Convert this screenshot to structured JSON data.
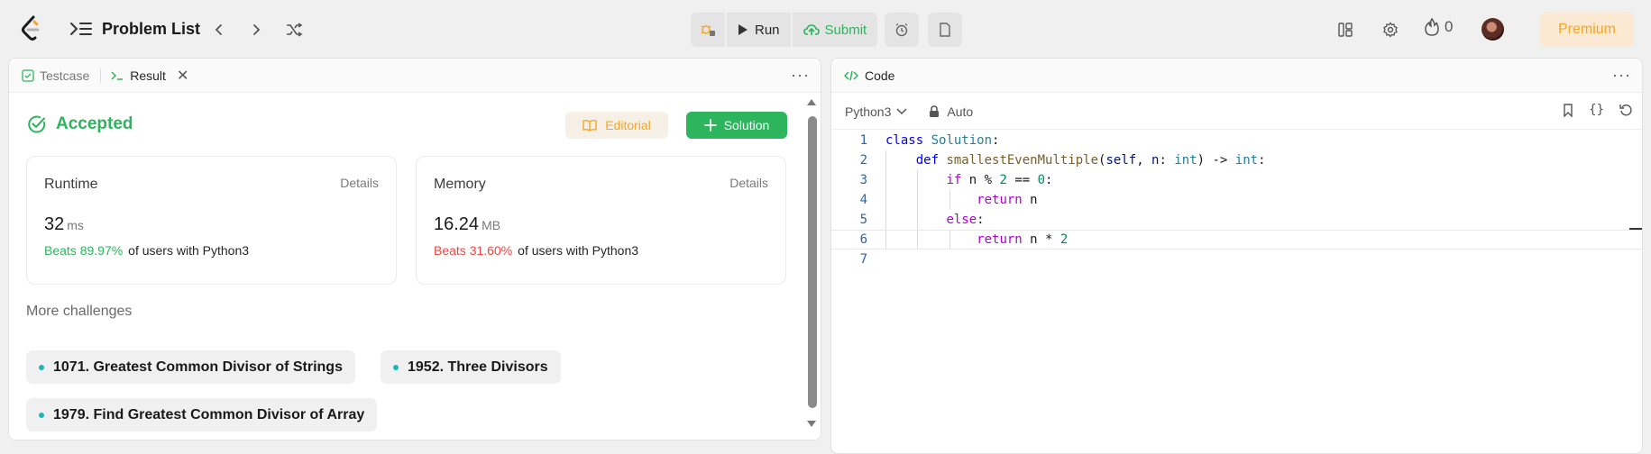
{
  "topbar": {
    "title": "Problem List",
    "run_label": "Run",
    "submit_label": "Submit",
    "streak_count": "0",
    "premium_label": "Premium"
  },
  "left_panel": {
    "tabs": [
      {
        "label": "Testcase"
      },
      {
        "label": "Result"
      }
    ],
    "status": "Accepted",
    "editorial_label": "Editorial",
    "solution_label": "Solution",
    "runtime": {
      "label": "Runtime",
      "details": "Details",
      "value": "32",
      "unit": "ms",
      "beats": "Beats 89.97%",
      "beats_suffix": "of users with Python3"
    },
    "memory": {
      "label": "Memory",
      "details": "Details",
      "value": "16.24",
      "unit": "MB",
      "beats": "Beats 31.60%",
      "beats_suffix": "of users with Python3"
    },
    "more_challenges_title": "More challenges",
    "challenges": [
      "1071. Greatest Common Divisor of Strings",
      "1952. Three Divisors",
      "1979. Find Greatest Common Divisor of Array"
    ]
  },
  "right_panel": {
    "tab_label": "Code",
    "language": "Python3",
    "mode": "Auto",
    "line_numbers": [
      "1",
      "2",
      "3",
      "4",
      "5",
      "6",
      "7"
    ]
  },
  "colors": {
    "accent_green": "#2db55d",
    "accent_orange": "#f5a623",
    "accent_red": "#ef4743"
  }
}
